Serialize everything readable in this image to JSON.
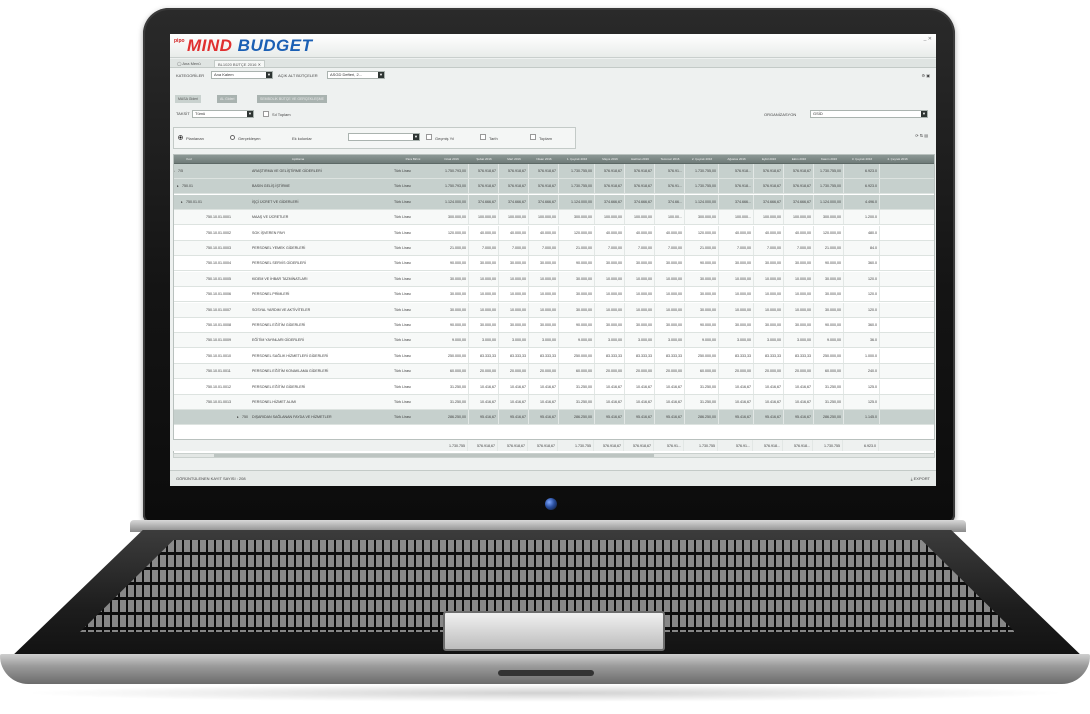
{
  "app": {
    "logo_prefix": "pipo",
    "logo_word1": "MIND",
    "logo_word2": " BUDGET",
    "window_controls": "_ ✕"
  },
  "tabs": [
    {
      "label": "Ana Menü"
    },
    {
      "label": "BL1020 BÜTÇE 2016"
    }
  ],
  "toolbar": {
    "category_label": "KATEGORİLER",
    "category_value": "Ana Kalem",
    "account_label": "AÇIK ALT BÜTÇELER",
    "account_value": "ASGD Defteri, 2...",
    "arrow": "▼"
  },
  "subtabs": [
    {
      "label": "MASA Gideri"
    },
    {
      "label": "AL Gideri"
    },
    {
      "label": "SEMBOLİK BÜTÇE VE GERÇEKLEŞME"
    }
  ],
  "filters": {
    "type_label": "TAKSİT",
    "type_value": "Tümü",
    "detail_label": "Sıl Toplam",
    "org_label": "ORGANİZASYON",
    "org_value": "GSİD",
    "plan_label": "Planlanan",
    "real_label": "Gerçekleşen",
    "all_label": "Ek kolonlar",
    "combo_value": "",
    "pct_label": "Geçmiş Yıl",
    "total_label": "Tarih",
    "fix_label": "Toplam"
  },
  "grid": {
    "headers": [
      "Kod",
      "Açıklama",
      "Para Birimi",
      "Ocak 2016",
      "Şubat 2016",
      "Mart 2016",
      "Nisan 2016",
      "1. Çeyrek 2016",
      "Mayıs 2016",
      "Haziran 2016",
      "Temmuz 2016",
      "2. Çeyrek 2016",
      "Ağustos 2016",
      "Eylül 2016",
      "Ekim 2016",
      "Kasım 2016",
      "3. Çeyrek 2016",
      "4. Çeyrek 2016"
    ],
    "rows": [
      {
        "kind": "group",
        "expander": "▸",
        "code": "7/5",
        "desc": "ARAŞTIRMA VE GELİŞTİRME GİDERLERİ",
        "cur": "Türk Lirası",
        "vals": [
          "1.750.793,00",
          "576.918,67",
          "576.918,67",
          "576.918,67",
          "1.730.755,00",
          "576.918,67",
          "576.918,67",
          "576.91...",
          "1.730.755,00",
          "576.918...",
          "576.918,67",
          "576.918,67",
          "1.730.755,00",
          "6.923.0"
        ]
      },
      {
        "kind": "group",
        "expander": "▸",
        "code": "750.01",
        "desc": "BASIN GELİŞ İŞTİRME",
        "cur": "Türk Lirası",
        "vals": [
          "1.750.793,00",
          "576.918,67",
          "576.918,67",
          "576.918,67",
          "1.730.755,00",
          "576.918,67",
          "576.918,67",
          "576.91...",
          "1.730.755,00",
          "576.918...",
          "576.918,67",
          "576.918,67",
          "1.730.755,00",
          "6.923.0"
        ]
      },
      {
        "kind": "group",
        "expander": "▸",
        "code": "750.01.01",
        "desc": "İŞÇİ ÜCRET VE GİDERLERİ",
        "cur": "Türk Lirası",
        "vals": [
          "1.124.000,00",
          "374.666,67",
          "374.666,67",
          "374.666,67",
          "1.124.000,00",
          "374.666,67",
          "374.666,67",
          "374.66...",
          "1.124.000,00",
          "374.666...",
          "374.666,67",
          "374.666,67",
          "1.124.000,00",
          "4.496.0"
        ]
      },
      {
        "kind": "row",
        "expander": "",
        "code": "750.10.01.0001",
        "desc": "MAAŞ VE ÜCRETLER",
        "cur": "Türk Lirası",
        "vals": [
          "300.000,00",
          "100.000,00",
          "100.000,00",
          "100.000,00",
          "300.000,00",
          "100.000,00",
          "100.000,00",
          "100.00...",
          "300.000,00",
          "100.000...",
          "100.000,00",
          "100.000,00",
          "300.000,00",
          "1.200.0"
        ]
      },
      {
        "kind": "row",
        "expander": "",
        "code": "750.10.01.0002",
        "desc": "SGK İŞVEREN PAYI",
        "cur": "Türk Lirası",
        "vals": [
          "120.000,00",
          "40.000,00",
          "40.000,00",
          "40.000,00",
          "120.000,00",
          "40.000,00",
          "40.000,00",
          "40.000,00",
          "120.000,00",
          "40.000,00",
          "40.000,00",
          "40.000,00",
          "120.000,00",
          "480.0"
        ]
      },
      {
        "kind": "row",
        "expander": "",
        "code": "750.10.01.0003",
        "desc": "PERSONEL YEMEK GİDERLERİ",
        "cur": "Türk Lirası",
        "vals": [
          "21.000,00",
          "7.000,00",
          "7.000,00",
          "7.000,00",
          "21.000,00",
          "7.000,00",
          "7.000,00",
          "7.000,00",
          "21.000,00",
          "7.000,00",
          "7.000,00",
          "7.000,00",
          "21.000,00",
          "84.0"
        ]
      },
      {
        "kind": "row",
        "expander": "",
        "code": "750.10.01.0004",
        "desc": "PERSONEL SERVİS GİDERLERİ",
        "cur": "Türk Lirası",
        "vals": [
          "90.000,00",
          "30.000,00",
          "30.000,00",
          "30.000,00",
          "90.000,00",
          "30.000,00",
          "30.000,00",
          "30.000,00",
          "90.000,00",
          "30.000,00",
          "30.000,00",
          "30.000,00",
          "90.000,00",
          "360.0"
        ]
      },
      {
        "kind": "row",
        "expander": "",
        "code": "750.10.01.0005",
        "desc": "KIDEM VE İHBAR TAZMİNATLARI",
        "cur": "Türk Lirası",
        "vals": [
          "30.000,00",
          "10.000,00",
          "10.000,00",
          "10.000,00",
          "30.000,00",
          "10.000,00",
          "10.000,00",
          "10.000,00",
          "30.000,00",
          "10.000,00",
          "10.000,00",
          "10.000,00",
          "30.000,00",
          "120.0"
        ]
      },
      {
        "kind": "row",
        "expander": "",
        "code": "750.10.01.0006",
        "desc": "PERSONEL PRİMLERİ",
        "cur": "Türk Lirası",
        "vals": [
          "30.000,00",
          "10.000,00",
          "10.000,00",
          "10.000,00",
          "30.000,00",
          "10.000,00",
          "10.000,00",
          "10.000,00",
          "30.000,00",
          "10.000,00",
          "10.000,00",
          "10.000,00",
          "30.000,00",
          "120.0"
        ]
      },
      {
        "kind": "row",
        "expander": "",
        "code": "750.10.01.0007",
        "desc": "SOSYAL YARDIM VE AKTİVİTELER",
        "cur": "Türk Lirası",
        "vals": [
          "30.000,00",
          "10.000,00",
          "10.000,00",
          "10.000,00",
          "30.000,00",
          "10.000,00",
          "10.000,00",
          "10.000,00",
          "30.000,00",
          "10.000,00",
          "10.000,00",
          "10.000,00",
          "30.000,00",
          "120.0"
        ]
      },
      {
        "kind": "row",
        "expander": "",
        "code": "750.10.01.0008",
        "desc": "PERSONEL EĞİTİM GİDERLERİ",
        "cur": "Türk Lirası",
        "vals": [
          "90.000,00",
          "30.000,00",
          "30.000,00",
          "30.000,00",
          "90.000,00",
          "30.000,00",
          "30.000,00",
          "30.000,00",
          "90.000,00",
          "30.000,00",
          "30.000,00",
          "30.000,00",
          "90.000,00",
          "360.0"
        ]
      },
      {
        "kind": "row",
        "expander": "",
        "code": "750.10.01.0009",
        "desc": "EĞİTİM YAYINLARI GİDERLERİ",
        "cur": "Türk Lirası",
        "vals": [
          "9.000,00",
          "3.000,00",
          "3.000,00",
          "3.000,00",
          "9.000,00",
          "3.000,00",
          "3.000,00",
          "3.000,00",
          "9.000,00",
          "3.000,00",
          "3.000,00",
          "3.000,00",
          "9.000,00",
          "36.0"
        ]
      },
      {
        "kind": "row",
        "expander": "",
        "code": "750.10.01.0010",
        "desc": "PERSONEL SAĞLIK HİZMETLERİ GİDERLERİ",
        "cur": "Türk Lirası",
        "vals": [
          "250.000,00",
          "83.333,33",
          "83.333,33",
          "83.333,33",
          "250.000,00",
          "83.333,33",
          "83.333,33",
          "83.333,33",
          "250.000,00",
          "83.333,33",
          "83.333,33",
          "83.333,33",
          "250.000,00",
          "1.000.0"
        ]
      },
      {
        "kind": "row",
        "expander": "",
        "code": "750.10.01.0011",
        "desc": "PERSONEL EĞİTİM KONAKLAMA GİDERLERİ",
        "cur": "Türk Lirası",
        "vals": [
          "60.000,00",
          "20.000,00",
          "20.000,00",
          "20.000,00",
          "60.000,00",
          "20.000,00",
          "20.000,00",
          "20.000,00",
          "60.000,00",
          "20.000,00",
          "20.000,00",
          "20.000,00",
          "60.000,00",
          "240.0"
        ]
      },
      {
        "kind": "row",
        "expander": "",
        "code": "750.10.01.0012",
        "desc": "PERSONEL EĞİTİM GİDERLERİ",
        "cur": "Türk Lirası",
        "vals": [
          "31.250,00",
          "10.416,67",
          "10.416,67",
          "10.416,67",
          "31.250,00",
          "10.416,67",
          "10.416,67",
          "10.416,67",
          "31.250,00",
          "10.416,67",
          "10.416,67",
          "10.416,67",
          "31.250,00",
          "125.0"
        ]
      },
      {
        "kind": "row",
        "expander": "",
        "code": "750.10.01.0013",
        "desc": "PERSONEL HİZMET ALIMI",
        "cur": "Türk Lirası",
        "vals": [
          "31.250,00",
          "10.416,67",
          "10.416,67",
          "10.416,67",
          "31.250,00",
          "10.416,67",
          "10.416,67",
          "10.416,67",
          "31.250,00",
          "10.416,67",
          "10.416,67",
          "10.416,67",
          "31.250,00",
          "125.0"
        ]
      },
      {
        "kind": "group",
        "expander": "▸",
        "code": "750.10.02",
        "desc": "DIŞARIDAN SAĞLANAN FAYDA VE HİZMETLER",
        "cur": "Türk Lirası",
        "vals": [
          "286.250,00",
          "95.416,67",
          "95.416,67",
          "95.416,67",
          "286.250,00",
          "95.416,67",
          "95.416,67",
          "95.416,67",
          "286.250,00",
          "95.416,67",
          "95.416,67",
          "95.416,67",
          "286.250,00",
          "1.145.0"
        ]
      }
    ],
    "totals": [
      "1.730.755",
      "576.918,67",
      "576.918,67",
      "576.918,67",
      "1.730.755",
      "576.918,67",
      "576.918,67",
      "576.91...",
      "1.730.755",
      "576.91...",
      "576.918...",
      "576.918...",
      "1.730.755",
      "6.923.0"
    ]
  },
  "status": {
    "record_count": "GÖRÜNTÜLENEN KAYIT SAYISI : 208",
    "export_label": "EXPORT"
  },
  "colors": {
    "logo_red": "#e03030",
    "logo_blue": "#1a5fb4",
    "header_grey": "#6f7b78",
    "group_row": "#c6d0cd"
  }
}
